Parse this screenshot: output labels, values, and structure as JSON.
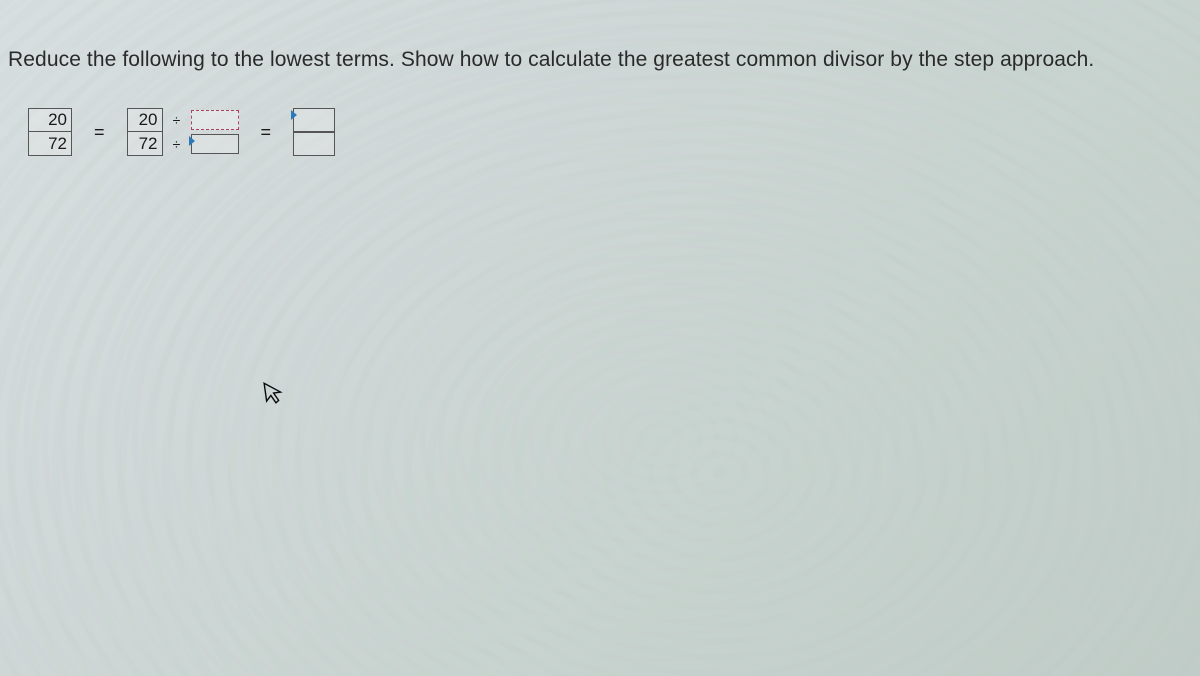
{
  "question": "Reduce the following to the lowest terms. Show how to calculate the greatest common divisor by the step approach.",
  "fraction": {
    "numerator": "20",
    "denominator": "72"
  },
  "equals": "=",
  "step": {
    "numerator": "20",
    "denominator": "72",
    "divide_symbol": "÷"
  },
  "cursor_glyph": "↖"
}
